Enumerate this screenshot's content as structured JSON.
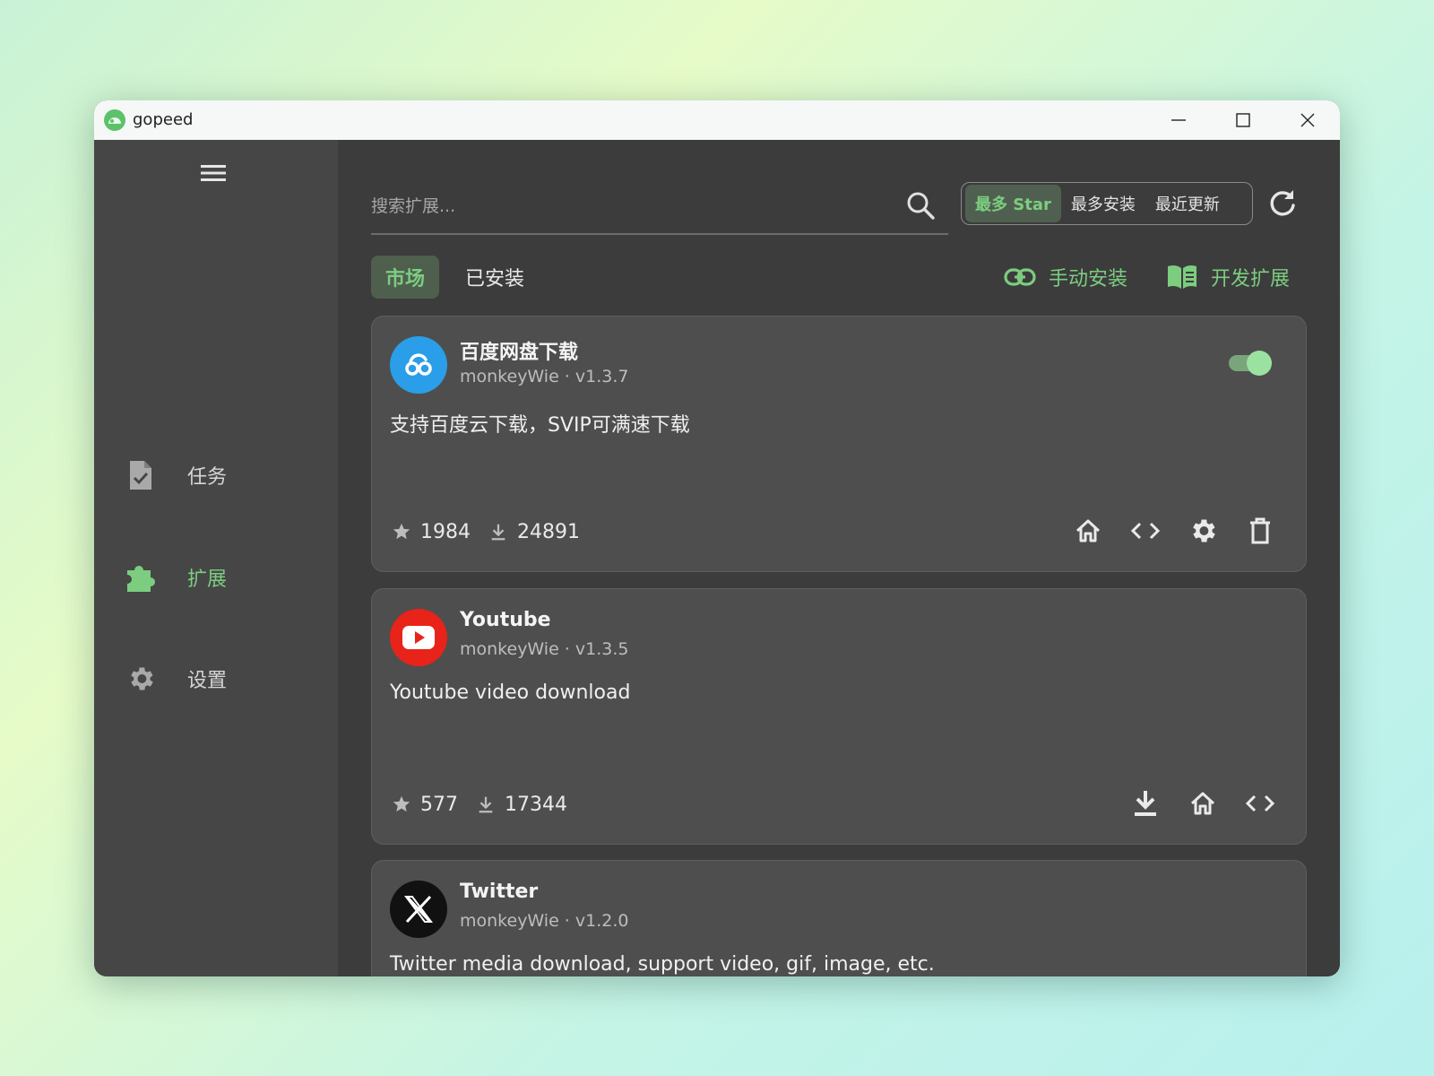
{
  "window": {
    "title": "gopeed"
  },
  "sidebar": {
    "items": [
      {
        "label": "任务",
        "icon": "file-check-icon"
      },
      {
        "label": "扩展",
        "icon": "puzzle-icon",
        "active": true
      },
      {
        "label": "设置",
        "icon": "gear-icon"
      }
    ]
  },
  "search": {
    "placeholder": "搜索扩展..."
  },
  "sort": {
    "options": [
      "最多 Star",
      "最多安装",
      "最近更新"
    ],
    "selected": "最多 Star"
  },
  "tabs": [
    {
      "label": "市场",
      "active": true
    },
    {
      "label": "已安装"
    }
  ],
  "actions": {
    "manual_install": "手动安装",
    "develop": "开发扩展"
  },
  "extensions": [
    {
      "name": "百度网盘下载",
      "meta": "monkeyWie · v1.3.7",
      "description": "支持百度云下载，SVIP可满速下载",
      "stars": "1984",
      "installs": "24891",
      "installed": true,
      "enabled": true,
      "logo_color": "#2a9ee8"
    },
    {
      "name": "Youtube",
      "meta": "monkeyWie · v1.3.5",
      "description": "Youtube video download",
      "stars": "577",
      "installs": "17344",
      "installed": false,
      "logo_color": "#e8231a"
    },
    {
      "name": "Twitter",
      "meta": "monkeyWie · v1.2.0",
      "description": "Twitter media download, support video, gif, image, etc.",
      "installed": false,
      "logo_color": "#111111"
    }
  ],
  "colors": {
    "accent": "#7ccd80",
    "sidebar_bg": "#464646",
    "main_bg": "#3c3c3c",
    "card_bg": "#4e4e4e"
  }
}
